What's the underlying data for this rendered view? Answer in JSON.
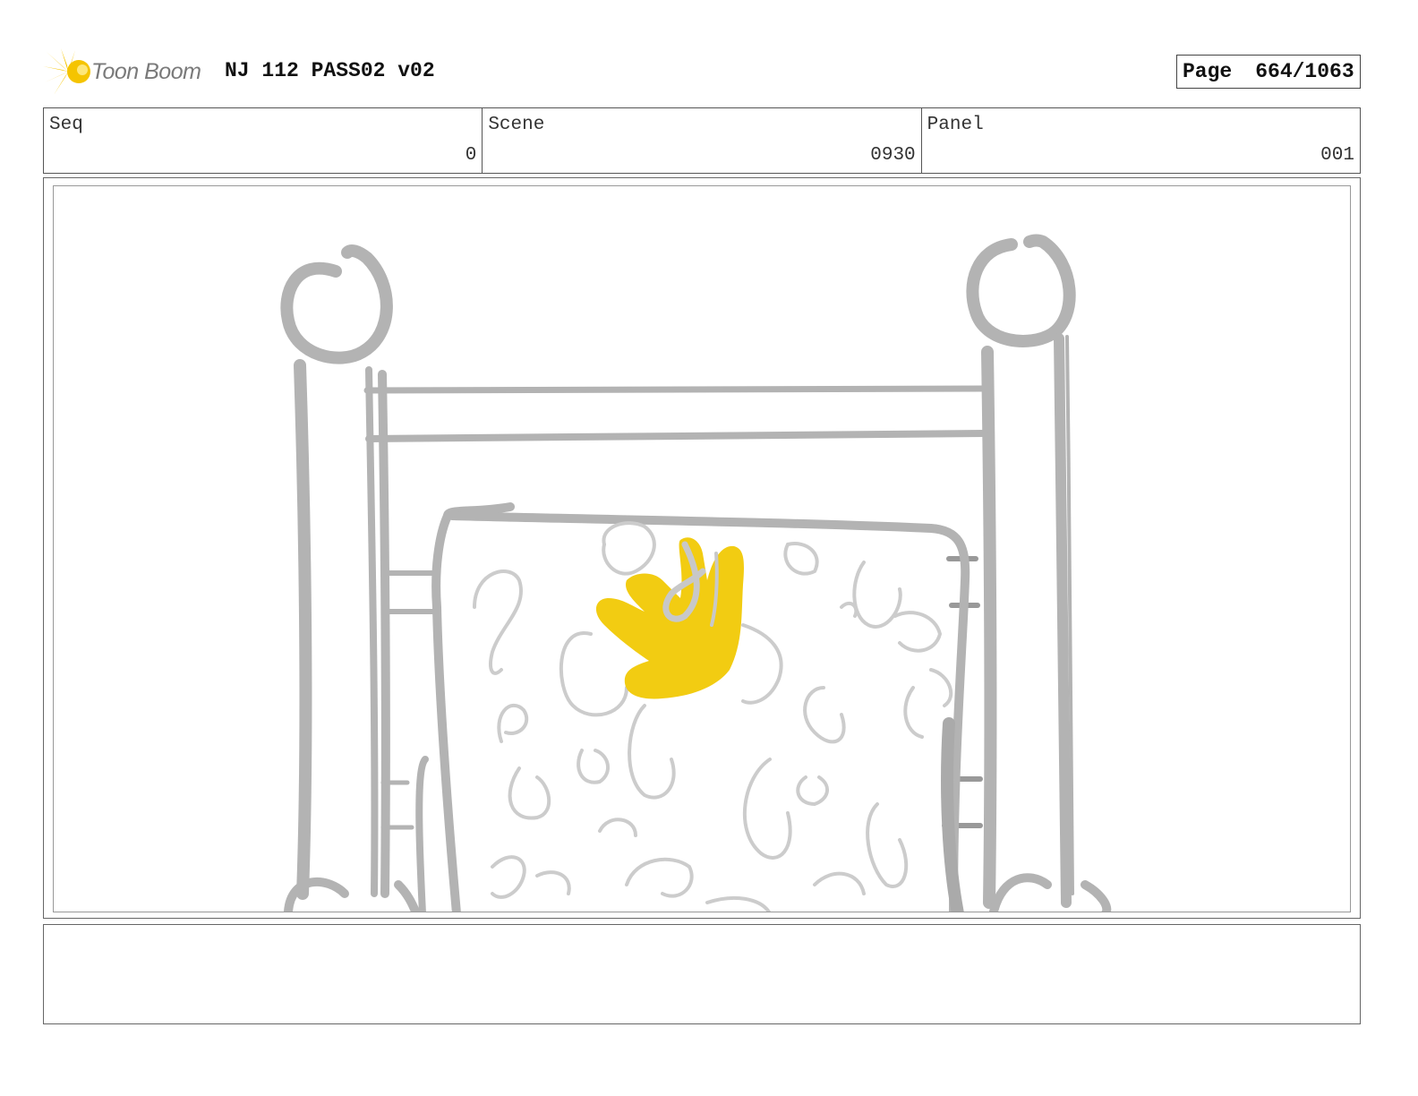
{
  "header": {
    "logo_text": "Toon Boom",
    "project_title": "NJ 112 PASS02 v02",
    "page_label": "Page",
    "page_value": "664/1063"
  },
  "meta": {
    "seq_label": "Seq",
    "seq_value": "0",
    "scene_label": "Scene",
    "scene_value": "0930",
    "panel_label": "Panel",
    "panel_value": "001"
  },
  "colors": {
    "sketch_gray": "#b3b3b3",
    "sketch_light": "#cccccc",
    "hand_yellow": "#f2cc12",
    "logo_yellow": "#f5c400"
  },
  "notes": {
    "text": ""
  }
}
